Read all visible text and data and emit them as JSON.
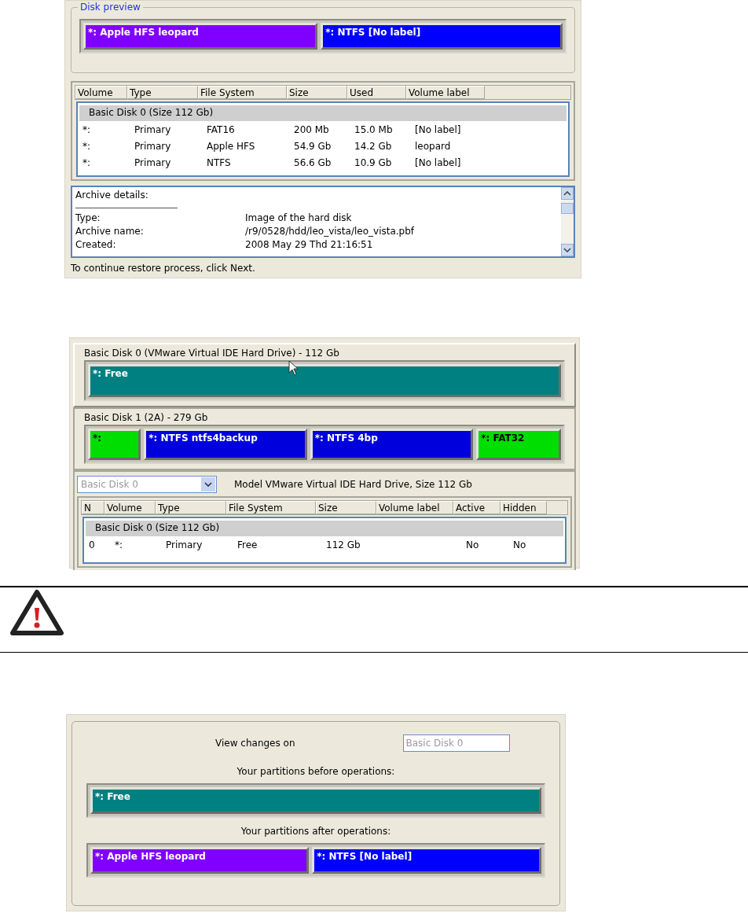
{
  "restore_screen": {
    "disk_preview": {
      "legend": "Disk preview",
      "partitions": [
        {
          "label": "*: Apple HFS leopard",
          "color": "#8000ff"
        },
        {
          "label": "*: NTFS [No label]",
          "color": "#0000ff"
        }
      ]
    },
    "volume_table": {
      "columns": [
        "Volume",
        "Type",
        "File System",
        "Size",
        "Used",
        "Volume label"
      ],
      "group": "Basic Disk 0 (Size 112 Gb)",
      "rows": [
        [
          "*:",
          "Primary",
          "FAT16",
          "200 Mb",
          "15.0 Mb",
          "[No label]"
        ],
        [
          "*:",
          "Primary",
          "Apple HFS",
          "54.9 Gb",
          "14.2 Gb",
          "leopard"
        ],
        [
          "*:",
          "Primary",
          "NTFS",
          "56.6 Gb",
          "10.9 Gb",
          "[No label]"
        ]
      ]
    },
    "archive_details": {
      "heading": "Archive details:",
      "fields": [
        {
          "label": "Type:",
          "value": "Image of the hard disk"
        },
        {
          "label": "Archive name:",
          "value": "/r9/0528/hdd/leo_vista/leo_vista.pbf"
        },
        {
          "label": "Created:",
          "value": "2008 May 29 Thd 21:16:51"
        }
      ]
    },
    "hint": "To continue restore process, click Next."
  },
  "disk_map_screen": {
    "disks": [
      {
        "title": "Basic Disk 0 (VMware Virtual IDE Hard Drive) - 112 Gb",
        "partitions": [
          {
            "label": "*: Free",
            "color": "#008080"
          }
        ]
      },
      {
        "title": "Basic Disk 1 (2A) - 279 Gb",
        "partitions": [
          {
            "label": "*:",
            "color": "#00dd00"
          },
          {
            "label": "*: NTFS ntfs4backup",
            "color": "#0000dd"
          },
          {
            "label": "*: NTFS 4bp",
            "color": "#0000dd"
          },
          {
            "label": "*: FAT32",
            "color": "#00dd00"
          }
        ]
      }
    ],
    "disk_select": {
      "value": "Basic Disk 0",
      "disabled": true
    },
    "model_info": "Model VMware Virtual IDE Hard Drive, Size 112 Gb",
    "table": {
      "columns": [
        "N",
        "Volume",
        "Type",
        "File System",
        "Size",
        "Volume label",
        "Active",
        "Hidden"
      ],
      "group": "Basic Disk 0 (Size 112 Gb)",
      "rows": [
        [
          "0",
          "*:",
          "Primary",
          "Free",
          "112 Gb",
          "",
          "No",
          "No"
        ]
      ]
    }
  },
  "changes_screen": {
    "view_label": "View changes on",
    "view_value": "Basic Disk 0",
    "view_disabled": true,
    "before_label": "Your partitions before operations:",
    "before": [
      {
        "label": "*: Free",
        "color": "#008080"
      }
    ],
    "after_label": "Your partitions after operations:",
    "after": [
      {
        "label": "*: Apple HFS leopard",
        "color": "#8000ff"
      },
      {
        "label": "*: NTFS [No label]",
        "color": "#0000ff"
      }
    ]
  }
}
